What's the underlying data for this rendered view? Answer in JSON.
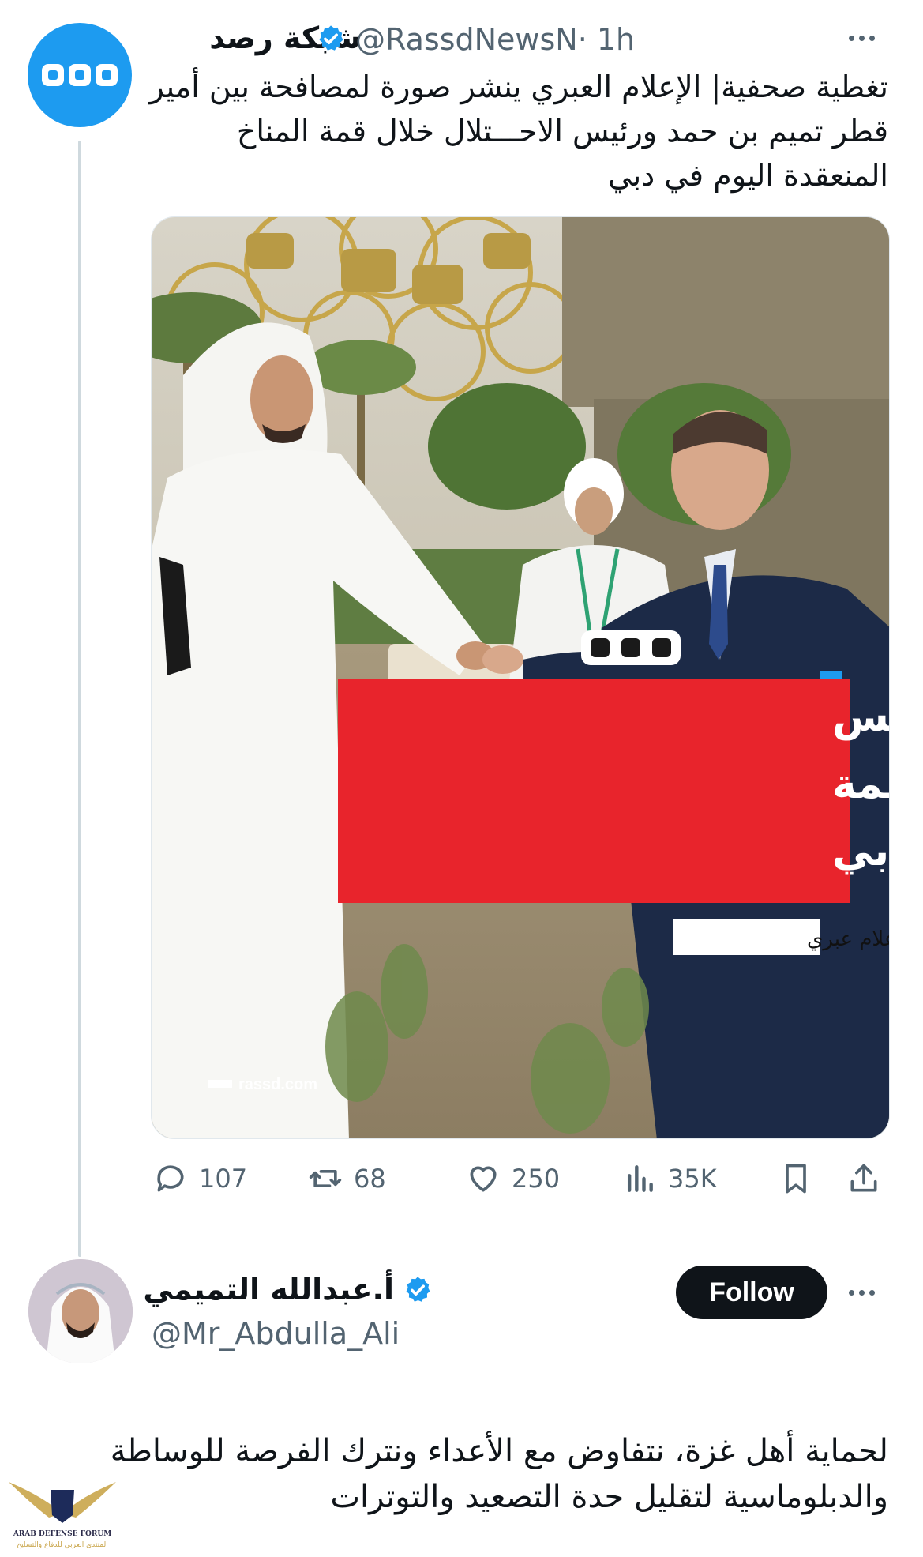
{
  "tweet": {
    "author_name": "شبكة رصد",
    "handle": "@RassdNewsN",
    "time": "· 1h",
    "text": "تغطية صحفية| الإعلام العبري ينشر صورة لمصافحة بين أمير قطر تميم بن حمد ورئيس الاحـــتلال خلال قمة المناخ المنعقدة اليوم في دبي",
    "media": {
      "headline_lines": [
        "أمير قطر يصافح رئيـس",
        "الاحـتـلال خلال قـمة",
        "المناخ في دبي"
      ],
      "source_tag": "إعلام عبري",
      "site": "rassd.com"
    },
    "stats": {
      "replies": "107",
      "reposts": "68",
      "likes": "250",
      "views": "35K"
    }
  },
  "reply": {
    "author_name": "أ.عبدالله التميمي",
    "handle": "@Mr_Abdulla_Ali",
    "follow_label": "Follow",
    "text": "لحماية أهل غزة، نتفاوض مع الأعداء ونترك الفرصة للوساطة والدبلوماسية لتقليل حدة التصعيد والتوترات"
  },
  "watermark": {
    "line1": "ARAB DEFENSE FORUM",
    "line2": "المنتدى العربي للدفاع والتسليح"
  },
  "colors": {
    "accent": "#1d9bf0",
    "muted": "#536471",
    "headline_red": "#e8242c"
  }
}
